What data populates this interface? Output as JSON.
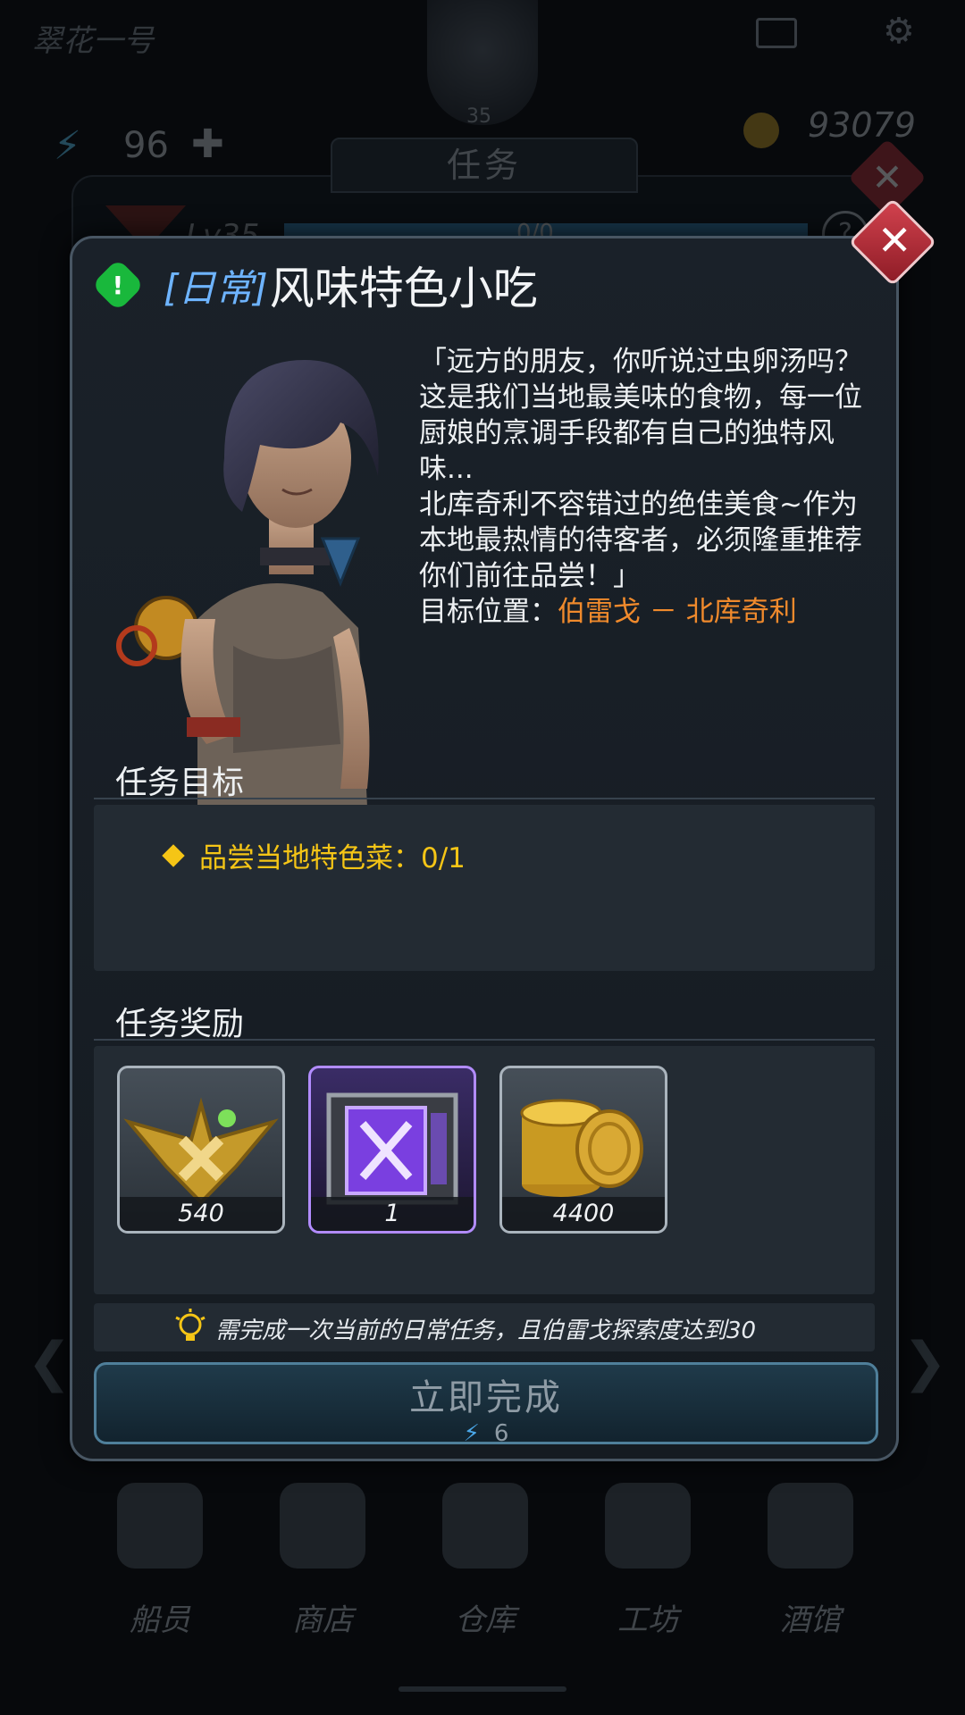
{
  "background": {
    "top_title": "翠花一号",
    "player_level": "35",
    "energy": "96",
    "gold": "93079",
    "panel_tab": "任务",
    "lv_label": "Lv35",
    "xp_progress": "0/0",
    "help_label": "?",
    "close_label": "✕",
    "dock": [
      {
        "label": "船员"
      },
      {
        "label": "商店"
      },
      {
        "label": "仓库"
      },
      {
        "label": "工坊"
      },
      {
        "label": "酒馆"
      }
    ]
  },
  "quest": {
    "tag": "[日常]",
    "title": "风味特色小吃",
    "alert_glyph": "!",
    "close_glyph": "✕",
    "dialogue": [
      "「远方的朋友，你听说过虫卵汤吗？这是我们当地最美味的食物，每一位厨娘的烹调手段都有自己的独特风味...",
      "北库奇利不容错过的绝佳美食~作为本地最热情的待客者，必须隆重推荐你们前往品尝！」"
    ],
    "location_label": "目标位置：",
    "location_value": "伯雷戈 － 北库奇利",
    "objectives_title": "任务目标",
    "objectives": [
      {
        "text": "品尝当地特色菜：0/1",
        "current": 0,
        "total": 1
      }
    ],
    "rewards_title": "任务奖励",
    "rewards": [
      {
        "icon": "rank-badge-icon",
        "count": "540"
      },
      {
        "icon": "purple-crate-icon",
        "count": "1"
      },
      {
        "icon": "gold-coins-icon",
        "count": "4400"
      }
    ],
    "hint": "需完成一次当前的日常任务，且伯雷戈探索度达到30",
    "complete_button": {
      "label": "立即完成",
      "cost": "6",
      "cost_icon": "energy-bolt-icon"
    }
  },
  "colors": {
    "tag_blue": "#6eb4ff",
    "location_orange": "#f08a2c",
    "objective_yellow": "#f5c516",
    "alert_green": "#19b83c",
    "close_red": "#c7343f",
    "rare_purple": "#b28cff"
  }
}
